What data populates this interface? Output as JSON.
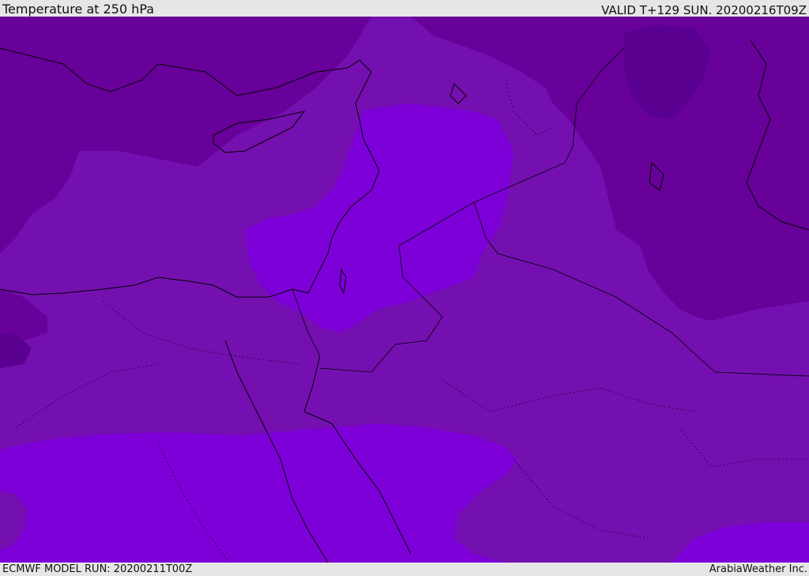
{
  "header": {
    "title": "Temperature at 250 hPa",
    "valid": "VALID T+129 SUN. 20200216T09Z"
  },
  "footer": {
    "model_run": "ECMWF MODEL RUN: 20200211T00Z",
    "credit": "ArabiaWeather Inc."
  },
  "map": {
    "field": "temperature",
    "level": "250 hPa",
    "colors": {
      "coldest": "#5a0090",
      "cold": "#68009a",
      "mid": "#7410b0",
      "warm": "#7d00d8",
      "coast": "#000000"
    }
  }
}
